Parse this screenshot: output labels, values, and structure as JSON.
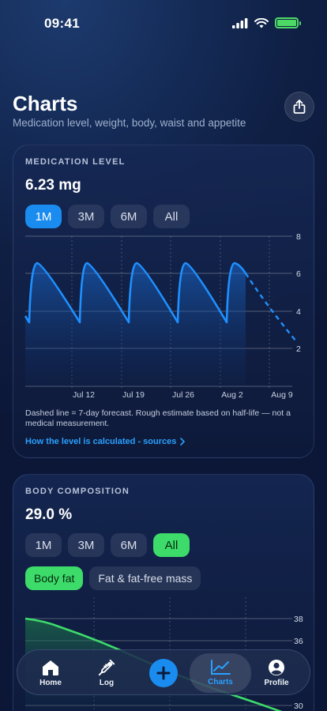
{
  "status": {
    "time": "09:41"
  },
  "header": {
    "title": "Charts",
    "subtitle": "Medication level, weight, body, waist and appetite"
  },
  "medication_card": {
    "label": "MEDICATION LEVEL",
    "value": "6.23 mg",
    "ranges": [
      "1M",
      "3M",
      "6M",
      "All"
    ],
    "selected_range": "1M",
    "note": "Dashed line = 7-day forecast. Rough estimate based on half-life — not a medical measurement.",
    "link": "How the level is calculated - sources",
    "chart_data": {
      "type": "line",
      "y_ticks": [
        "8",
        "6",
        "4",
        "2"
      ],
      "x_ticks": [
        "Jul 12",
        "Jul 19",
        "Jul 26",
        "Aug 2",
        "Aug 9"
      ],
      "ylim": [
        0,
        8
      ],
      "series": [
        {
          "points": [
            [
              "Jul 5",
              3.8
            ],
            [
              "Jul 6",
              3.5
            ],
            [
              "Jul 7",
              6.6
            ],
            [
              "Jul 12",
              3.4
            ],
            [
              "Jul 14",
              6.6
            ],
            [
              "Jul 19",
              3.4
            ],
            [
              "Jul 21",
              6.6
            ],
            [
              "Jul 26",
              3.4
            ],
            [
              "Jul 28",
              6.6
            ],
            [
              "Aug 2",
              3.4
            ],
            [
              "Aug 4",
              6.6
            ]
          ],
          "style": "solid"
        },
        {
          "points": [
            [
              "Aug 4",
              6.6
            ],
            [
              "Aug 7",
              4.6
            ],
            [
              "Aug 10",
              3.3
            ],
            [
              "Aug 11",
              2.4
            ]
          ],
          "style": "dashed"
        }
      ]
    }
  },
  "body_card": {
    "label": "BODY COMPOSITION",
    "value": "29.0 %",
    "ranges": [
      "1M",
      "3M",
      "6M",
      "All"
    ],
    "selected_range": "All",
    "toggles": [
      "Body fat",
      "Fat & fat-free mass"
    ],
    "selected_toggle": "Body fat",
    "chart_data": {
      "type": "line",
      "y_ticks": [
        "38",
        "36",
        "30"
      ],
      "series": [
        {
          "values": [
            38.0,
            37.3,
            36.3,
            35.2,
            34.2,
            33.4,
            32.4,
            31.6,
            30.8,
            30.0,
            29.0
          ]
        }
      ]
    }
  },
  "tabbar": {
    "home": "Home",
    "log": "Log",
    "charts": "Charts",
    "profile": "Profile"
  },
  "colors": {
    "accent_blue": "#1a8cf0",
    "accent_green": "#3ddc6a"
  }
}
